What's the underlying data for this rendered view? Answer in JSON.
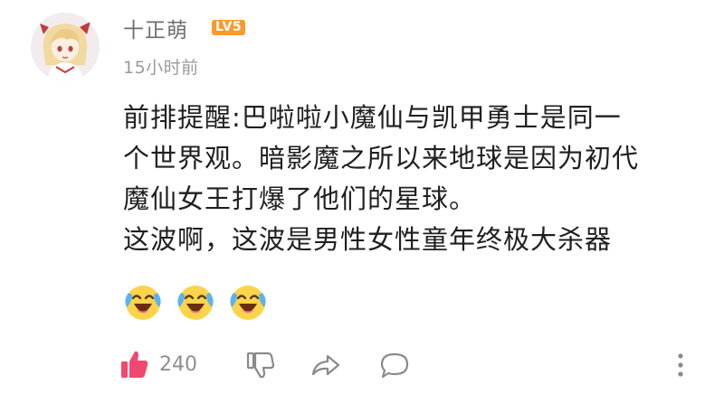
{
  "comment": {
    "username": "十正萌",
    "level_badge": "LV5",
    "timestamp": "15小时前",
    "content_lines": [
      "前排提醒:巴啦啦小魔仙与凯甲勇士是同一",
      "个世界观。暗影魔之所以来地球是因为初代",
      "魔仙女王打爆了他们的星球。",
      "这波啊，这波是男性女性童年终极大杀器"
    ],
    "emojis": [
      "laugh-cry-emoji",
      "laugh-cry-emoji",
      "laugh-cry-emoji"
    ]
  },
  "actions": {
    "like_count": "240",
    "icons": [
      "thumbs-up-icon",
      "thumbs-down-icon",
      "share-icon",
      "reply-icon",
      "more-icon"
    ]
  },
  "colors": {
    "like_accent": "#f0486f",
    "badge": "#fb9a2a",
    "username": "#6e6e6e",
    "meta": "#9a9a9a",
    "body_text": "#1f1f1f"
  }
}
